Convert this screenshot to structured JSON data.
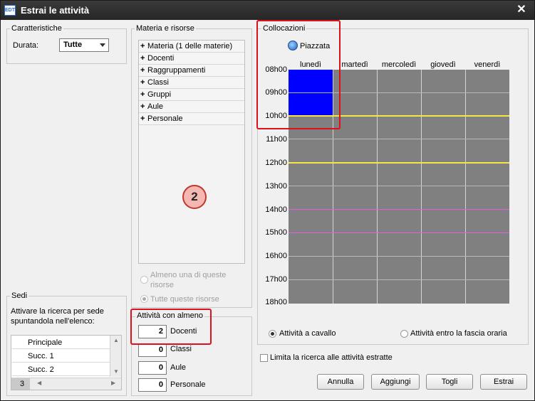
{
  "window": {
    "title": "Estrai le attività",
    "app_icon_text": "EDT"
  },
  "caratteristiche": {
    "legend": "Caratteristiche",
    "durata_label": "Durata:",
    "durata_value": "Tutte"
  },
  "sedi": {
    "legend": "Sedi",
    "description": "Attivare la ricerca per sede spuntandola nell'elenco:",
    "items": [
      "Principale",
      "Succ. 1",
      "Succ. 2"
    ],
    "count": "3"
  },
  "materia": {
    "legend": "Materia e risorse",
    "tree": [
      "Materia (1 delle materie)",
      "Docenti",
      "Raggruppamenti",
      "Classi",
      "Gruppi",
      "Aule",
      "Personale"
    ],
    "badge": "2",
    "option_any": "Almeno una di queste risorse",
    "option_all": "Tutte queste risorse"
  },
  "attivita": {
    "legend": "Attività con almeno",
    "rows": [
      {
        "value": "2",
        "label": "Docenti"
      },
      {
        "value": "0",
        "label": "Classi"
      },
      {
        "value": "0",
        "label": "Aule"
      },
      {
        "value": "0",
        "label": "Personale"
      }
    ]
  },
  "collocazioni": {
    "legend": "Collocazioni",
    "piazzata_label": "Piazzata",
    "days": [
      "lunedì",
      "martedì",
      "mercoledì",
      "giovedì",
      "venerdì"
    ],
    "hours": [
      "08h00",
      "09h00",
      "10h00",
      "11h00",
      "12h00",
      "13h00",
      "14h00",
      "15h00",
      "16h00",
      "17h00",
      "18h00"
    ],
    "option_cavallo": "Attività a cavallo",
    "option_fascia": "Attività entro la fascia oraria",
    "colors": {
      "selected": "#0000ff",
      "grid": "#808080",
      "yellow_line": "#f5e642",
      "magenta_line": "#e060e0"
    }
  },
  "limita_label": "Limita la ricerca alle attività estratte",
  "buttons": {
    "annulla": "Annulla",
    "aggiungi": "Aggiungi",
    "togli": "Togli",
    "estrai": "Estrai"
  }
}
